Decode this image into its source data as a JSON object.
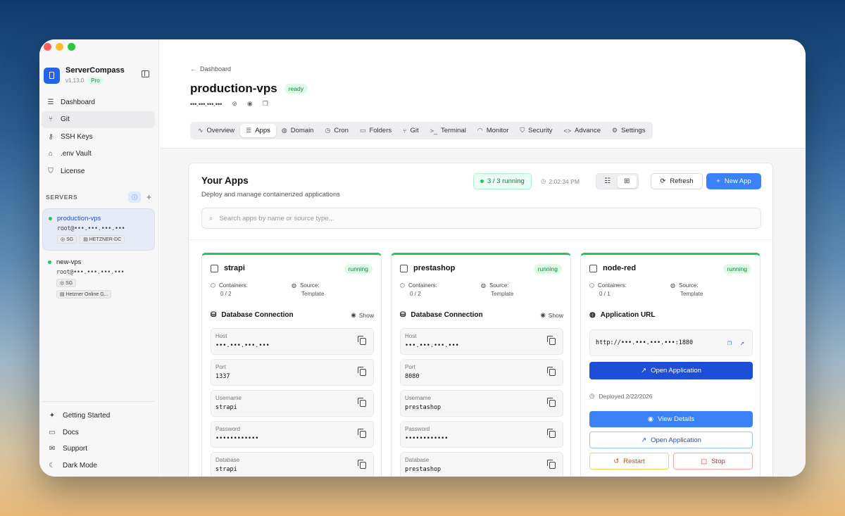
{
  "sidebar": {
    "app_name": "ServerCompass",
    "version": "v1.13.0",
    "plan": "Pro",
    "nav": [
      {
        "label": "Dashboard",
        "icon": "server-icon"
      },
      {
        "label": "Git",
        "icon": "git-branch-icon"
      },
      {
        "label": "SSH Keys",
        "icon": "key-icon"
      },
      {
        "label": ".env Vault",
        "icon": "lock-icon"
      },
      {
        "label": "License",
        "icon": "shield-icon"
      }
    ],
    "servers_title": "SERVERS",
    "servers": [
      {
        "name": "production-vps",
        "host": "root@•••.•••.•••.•••",
        "tags": [
          "SG",
          "HETZNER-DC"
        ]
      },
      {
        "name": "new-vps",
        "host": "root@•••.•••.•••.•••",
        "tags": [
          "SG",
          "Hetzner Online G..."
        ]
      }
    ],
    "bottom": [
      {
        "label": "Getting Started",
        "icon": "sparkles-icon"
      },
      {
        "label": "Docs",
        "icon": "book-icon"
      },
      {
        "label": "Support",
        "icon": "mail-icon"
      },
      {
        "label": "Dark Mode",
        "icon": "moon-icon"
      }
    ]
  },
  "header": {
    "breadcrumb": "Dashboard",
    "title": "production-vps",
    "status": "ready",
    "host_masked": "•••.•••.•••.•••"
  },
  "tabs": [
    {
      "label": "Overview",
      "icon": "activity-icon"
    },
    {
      "label": "Apps",
      "icon": "layers-icon"
    },
    {
      "label": "Domain",
      "icon": "globe-icon"
    },
    {
      "label": "Cron",
      "icon": "clock-icon"
    },
    {
      "label": "Folders",
      "icon": "folder-icon"
    },
    {
      "label": "Git",
      "icon": "git-branch-icon"
    },
    {
      "label": "Terminal",
      "icon": "terminal-icon"
    },
    {
      "label": "Monitor",
      "icon": "gauge-icon"
    },
    {
      "label": "Security",
      "icon": "shield-icon"
    },
    {
      "label": "Advance",
      "icon": "code-icon"
    },
    {
      "label": "Settings",
      "icon": "gear-icon"
    }
  ],
  "apps_panel": {
    "title": "Your Apps",
    "subtitle": "Deploy and manage containerized applications",
    "running": "3 / 3 running",
    "time": "2:02:34 PM",
    "refresh_label": "Refresh",
    "new_app_label": "New App",
    "search_placeholder": "Search apps by name or source type..."
  },
  "apps": [
    {
      "name": "strapi",
      "status": "running",
      "containers_label": "Containers:",
      "containers": "0 / 2",
      "source_label": "Source:",
      "source": "Template",
      "section": "Database Connection",
      "show": "Show",
      "fields": [
        {
          "label": "Host",
          "value": "•••.•••.•••.•••"
        },
        {
          "label": "Port",
          "value": "1337"
        },
        {
          "label": "Username",
          "value": "strapi"
        },
        {
          "label": "Password",
          "value": "••••••••••••"
        },
        {
          "label": "Database",
          "value": "strapi"
        }
      ]
    },
    {
      "name": "prestashop",
      "status": "running",
      "containers_label": "Containers:",
      "containers": "0 / 2",
      "source_label": "Source:",
      "source": "Template",
      "section": "Database Connection",
      "show": "Show",
      "fields": [
        {
          "label": "Host",
          "value": "•••.•••.•••.•••"
        },
        {
          "label": "Port",
          "value": "8080"
        },
        {
          "label": "Username",
          "value": "prestashop"
        },
        {
          "label": "Password",
          "value": "••••••••••••"
        },
        {
          "label": "Database",
          "value": "prestashop"
        }
      ]
    },
    {
      "name": "node-red",
      "status": "running",
      "containers_label": "Containers:",
      "containers": "0 / 1",
      "source_label": "Source:",
      "source": "Template",
      "section": "Application URL",
      "url": "http://•••.•••.•••.•••:1880",
      "open_app_label": "Open Application",
      "deployed": "Deployed 2/22/2026",
      "view_details_label": "View Details",
      "open_app_outline_label": "Open Application",
      "restart_label": "Restart",
      "stop_label": "Stop"
    }
  ]
}
